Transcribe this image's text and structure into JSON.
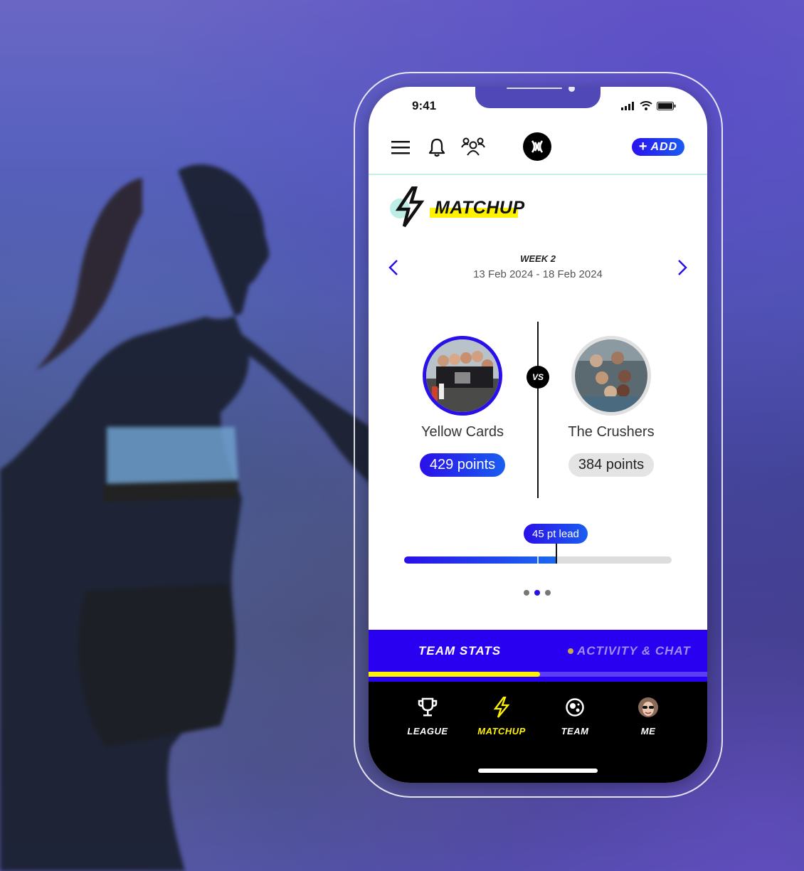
{
  "status_bar": {
    "time": "9:41"
  },
  "header": {
    "add_label": "ADD"
  },
  "section": {
    "title": "MATCHUP"
  },
  "week": {
    "label": "WEEK 2",
    "dates": "13 Feb 2024 - 18 Feb 2024"
  },
  "matchup": {
    "vs_label": "VS",
    "teams": [
      {
        "name": "Yellow Cards",
        "points_label": "429 points",
        "points": 429
      },
      {
        "name": "The Crushers",
        "points_label": "384 points",
        "points": 384
      }
    ],
    "lead_label": "45 pt lead",
    "lead_progress_fraction": 0.57,
    "carousel": {
      "pages": 3,
      "active_index": 1
    }
  },
  "tabs": [
    {
      "label": "TEAM STATS",
      "active": true
    },
    {
      "label": "ACTIVITY & CHAT",
      "active": false,
      "has_notification": true
    }
  ],
  "tab_indicator_fraction": 0.5,
  "bottom_nav": [
    {
      "label": "LEAGUE",
      "icon": "trophy-icon",
      "active": false
    },
    {
      "label": "MATCHUP",
      "icon": "lightning-icon",
      "active": true
    },
    {
      "label": "TEAM",
      "icon": "team-circle-icon",
      "active": false
    },
    {
      "label": "ME",
      "icon": "profile-avatar",
      "active": false
    }
  ],
  "colors": {
    "accent_blue": "#2a10e8",
    "accent_yellow": "#fff200",
    "mint": "#bdeee6",
    "nav_bg": "#000000"
  }
}
